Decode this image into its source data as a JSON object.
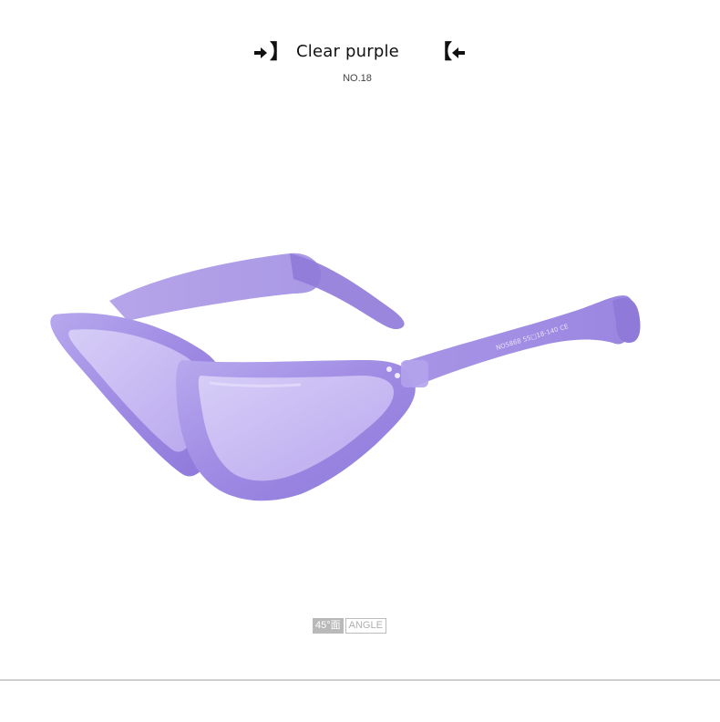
{
  "header": {
    "title": "Clear purple",
    "bracket_right": "】",
    "bracket_left": "【",
    "model_number": "NO.18",
    "arrow_right_icon": "arrow-right-icon",
    "arrow_left_icon": "arrow-left-icon"
  },
  "product": {
    "frame_color": "#a997e6",
    "lens_color": "#c9bcf3",
    "temple_print": "NO5868 55□18-140 CE"
  },
  "badge": {
    "degree": "45°面",
    "word": "ANGLE"
  },
  "colors": {
    "background": "#ffffff",
    "text": "#111111",
    "badge_gray": "#b9b9b9",
    "rule": "#cfcfcf"
  }
}
